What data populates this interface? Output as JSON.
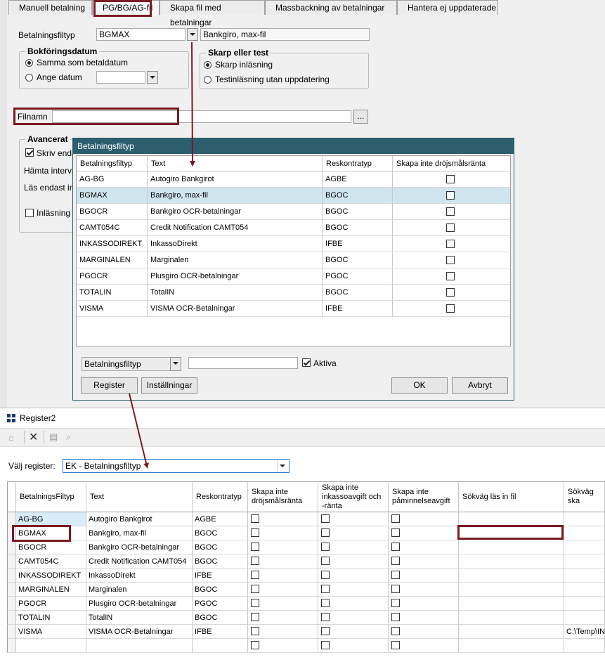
{
  "tabs": [
    "Manuell betalning",
    "PG/BG/AG-fil",
    "Skapa fil med betalningar",
    "Massbackning av betalningar",
    "Hantera ej uppdaterade"
  ],
  "form": {
    "filtyp_label": "Betalningsfiltyp",
    "filtyp_value": "BGMAX",
    "filtyp_desc": "Bankgiro, max-fil",
    "bokforing_title": "Bokföringsdatum",
    "radio_same": "Samma som betaldatum",
    "radio_date": "Ange datum",
    "skarp_title": "Skarp eller test",
    "radio_skarp": "Skarp inläsning",
    "radio_test": "Testinläsning utan uppdatering",
    "filnamn_label": "Filnamn",
    "browse_label": "...",
    "avancerat_title": "Avancerat",
    "skriv_label": "Skriv enda",
    "hamta_label": "Hämta interva",
    "las_label": "Läs endast in",
    "inlasning_label": "Inläsning f"
  },
  "dialog": {
    "title": "Betalningsfiltyp",
    "columns": [
      "Betalningsfiltyp",
      "Text",
      "Reskontratyp",
      "Skapa inte dröjsmålsränta"
    ],
    "rows": [
      [
        "AG-BG",
        "Autogiro Bankgirot",
        "AGBE"
      ],
      [
        "BGMAX",
        "Bankgiro, max-fil",
        "BGOC"
      ],
      [
        "BGOCR",
        "Bankgiro OCR-betalningar",
        "BGOC"
      ],
      [
        "CAMT054C",
        "Credit Notification CAMT054",
        "BGOC"
      ],
      [
        "INKASSODIREKT",
        "InkassoDirekt",
        "IFBE"
      ],
      [
        "MARGINALEN",
        "Marginalen",
        "BGOC"
      ],
      [
        "PGOCR",
        "Plusgiro OCR-betalningar",
        "PGOC"
      ],
      [
        "TOTALIN",
        "TotalIN",
        "BGOC"
      ],
      [
        "VISMA",
        "VISMA OCR-Betalningar",
        "IFBE"
      ]
    ],
    "selected_row": 1,
    "filter_select": "Betalningsfiltyp",
    "filter_text": "",
    "aktiva_label": "Aktiva",
    "btn_register": "Register",
    "btn_installningar": "Inställningar",
    "btn_ok": "OK",
    "btn_avbryt": "Avbryt"
  },
  "register": {
    "title": "Register2",
    "valj_label": "Välj register:",
    "valj_value": "EK - Betalningsfiltyp",
    "columns": [
      "BetalningsFiltyp",
      "Text",
      "Reskontratyp",
      "Skapa inte dröjsmålsränta",
      "Skapa inte inkassoavgift och -ränta",
      "Skapa inte påminnelseavgift",
      "Sökväg läs in fil",
      "Sökväg ska"
    ],
    "rows": [
      [
        "AG-BG",
        "Autogiro Bankgirot",
        "AGBE",
        ""
      ],
      [
        "BGMAX",
        "Bankgiro, max-fil",
        "BGOC",
        ""
      ],
      [
        "BGOCR",
        "Bankgiro OCR-betalningar",
        "BGOC",
        ""
      ],
      [
        "CAMT054C",
        "Credit Notification CAMT054",
        "BGOC",
        ""
      ],
      [
        "INKASSODIREKT",
        "InkassoDirekt",
        "IFBE",
        ""
      ],
      [
        "MARGINALEN",
        "Marginalen",
        "BGOC",
        ""
      ],
      [
        "PGOCR",
        "Plusgiro OCR-betalningar",
        "PGOC",
        ""
      ],
      [
        "TOTALIN",
        "TotalIN",
        "BGOC",
        ""
      ],
      [
        "VISMA",
        "VISMA OCR-Betalningar",
        "IFBE",
        "C:\\Temp\\IN"
      ],
      [
        "",
        "",
        "",
        ""
      ]
    ]
  },
  "colors": {
    "accent_red": "#7b1a22",
    "dialog_title": "#2c5e6e",
    "selected_row": "#cfe6ef",
    "combo_border": "#2a7cc7"
  }
}
